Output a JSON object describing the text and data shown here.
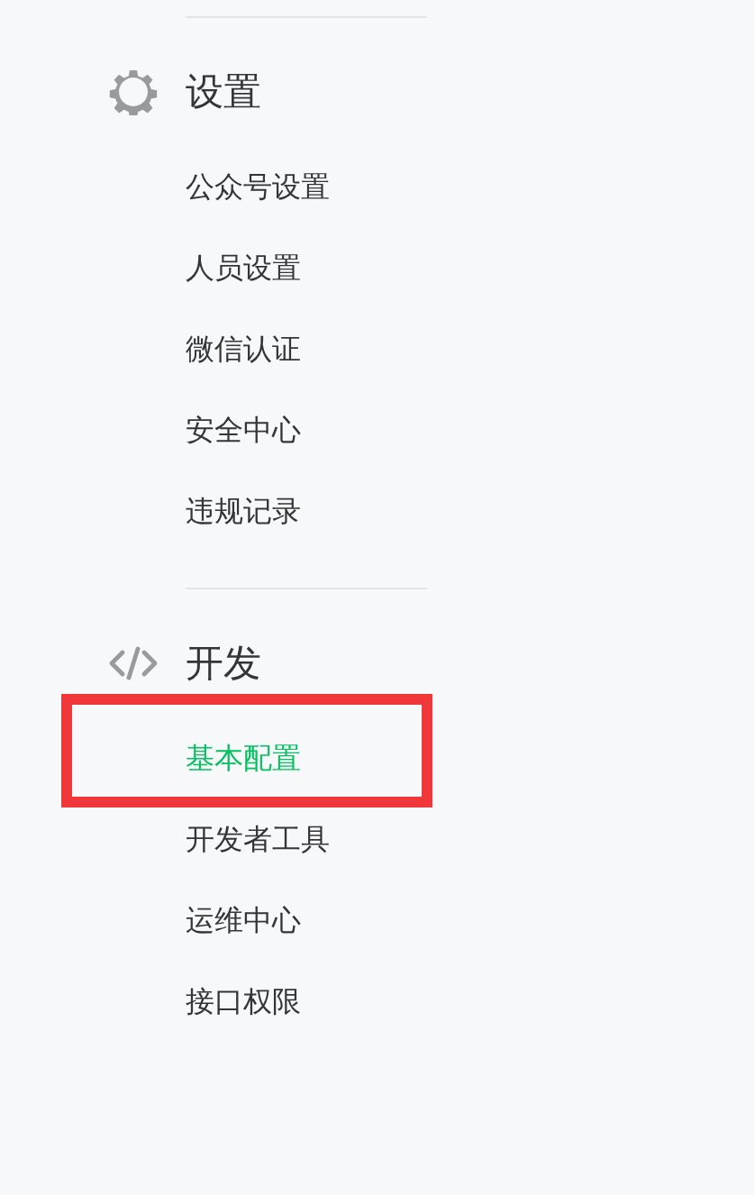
{
  "sections": [
    {
      "title": "设置",
      "kind": "settings",
      "items": [
        {
          "label": "公众号设置",
          "selected": false,
          "highlighted": false
        },
        {
          "label": "人员设置",
          "selected": false,
          "highlighted": false
        },
        {
          "label": "微信认证",
          "selected": false,
          "highlighted": false
        },
        {
          "label": "安全中心",
          "selected": false,
          "highlighted": false
        },
        {
          "label": "违规记录",
          "selected": false,
          "highlighted": false
        }
      ]
    },
    {
      "title": "开发",
      "kind": "development",
      "items": [
        {
          "label": "基本配置",
          "selected": true,
          "highlighted": true
        },
        {
          "label": "开发者工具",
          "selected": false,
          "highlighted": false
        },
        {
          "label": "运维中心",
          "selected": false,
          "highlighted": false
        },
        {
          "label": "接口权限",
          "selected": false,
          "highlighted": false
        }
      ]
    }
  ]
}
